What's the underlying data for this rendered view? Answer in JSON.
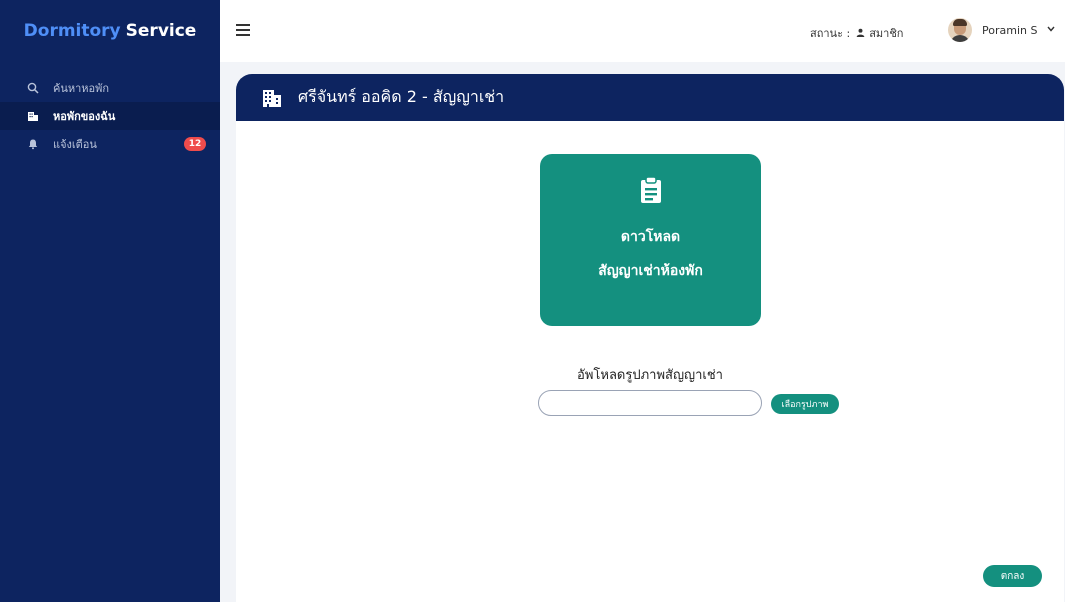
{
  "sidebar": {
    "brand_part1": "Dormitory",
    "brand_part2": "Service",
    "items": [
      {
        "label": "ค้นหาหอพัก",
        "icon": "search-icon"
      },
      {
        "label": "หอพักของฉัน",
        "icon": "building-icon"
      },
      {
        "label": "แจ้งเตือน",
        "icon": "bell-icon",
        "badge": "12"
      }
    ]
  },
  "topbar": {
    "status_label": "สถานะ :",
    "status_value": "สมาชิก",
    "user_name": "Poramin S"
  },
  "panel": {
    "title": "ศรีจันทร์ ออคิด 2 - สัญญาเช่า",
    "download_line1": "ดาวโหลด",
    "download_line2": "สัญญาเช่าห้องพัก",
    "upload_label": "อัพโหลดรูปภาพสัญญาเช่า",
    "file_input_value": "",
    "choose_button": "เลือกรูปภาพ",
    "ok_button": "ตกลง"
  },
  "colors": {
    "sidebar": "#0d2460",
    "brand_accent": "#4f8ff7",
    "teal": "#14907f",
    "badge": "#ef4c4c"
  }
}
